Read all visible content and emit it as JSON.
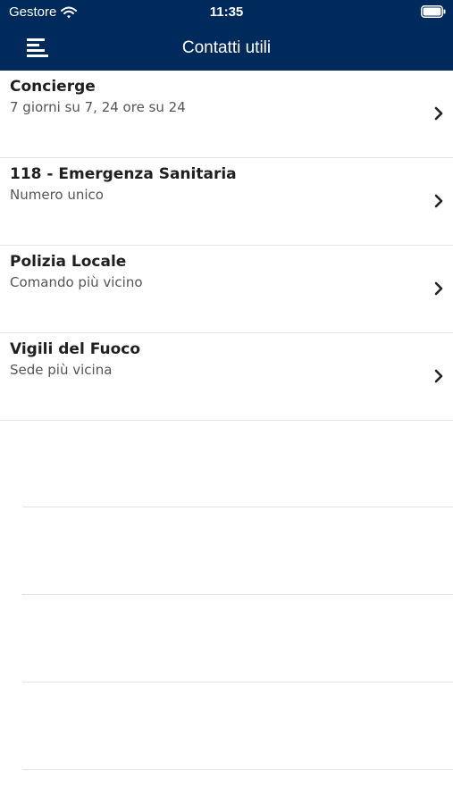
{
  "status_bar": {
    "carrier": "Gestore",
    "time": "11:35",
    "wifi_icon": "wifi-icon",
    "battery_icon": "battery-icon"
  },
  "nav": {
    "title": "Contatti utili",
    "menu_icon": "hamburger-menu-icon"
  },
  "colors": {
    "header_background": "#002a5c",
    "header_text": "#ffffff",
    "title_text": "#1f1f1f",
    "subtitle_text": "#555555",
    "separator": "#e4e4e4"
  },
  "contacts": [
    {
      "title": "Concierge",
      "subtitle": "7 giorni su 7, 24 ore su 24",
      "icon": "chevron-right-icon"
    },
    {
      "title": "118 - Emergenza Sanitaria",
      "subtitle": "Numero unico",
      "icon": "chevron-right-icon"
    },
    {
      "title": "Polizia Locale",
      "subtitle": "Comando più vicino",
      "icon": "chevron-right-icon"
    },
    {
      "title": "Vigili del Fuoco",
      "subtitle": "Sede più vicina",
      "icon": "chevron-right-icon"
    }
  ]
}
